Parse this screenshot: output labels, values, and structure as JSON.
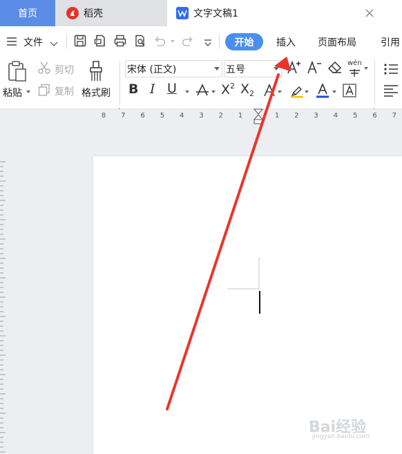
{
  "tabs": {
    "home_label": "首页",
    "daoke_label": "稻壳",
    "doc_label": "文字文稿1"
  },
  "menu": {
    "file_label": "文件",
    "start_tab": "开始",
    "insert_tab": "插入",
    "layout_tab": "页面布局",
    "reference_tab": "引用"
  },
  "ribbon": {
    "paste_label": "粘贴",
    "cut_label": "剪切",
    "copy_label": "复制",
    "format_painter_label": "格式刷",
    "font_name": "宋体 (正文)",
    "font_size": "五号",
    "phonetic_label": "wén"
  },
  "ruler": {
    "left_numbers": [
      "8",
      "7",
      "6",
      "5",
      "4",
      "3",
      "2",
      "1"
    ],
    "right_numbers": [
      "1",
      "2",
      "3",
      "4",
      "5",
      "6",
      "7"
    ]
  },
  "watermark": {
    "brand_text": "Bai经验",
    "url_text": "jingyan.baidu.com"
  },
  "colors": {
    "accent_blue": "#4a8ef0",
    "home_tab_blue": "#5b8de6",
    "arrow_red": "#e8362a",
    "font_color_underline": "#1e4fd6"
  },
  "icons": {
    "menu": "hamburger-icon",
    "save": "save-icon",
    "print": "print-icon",
    "undo": "undo-icon",
    "redo": "redo-icon"
  }
}
